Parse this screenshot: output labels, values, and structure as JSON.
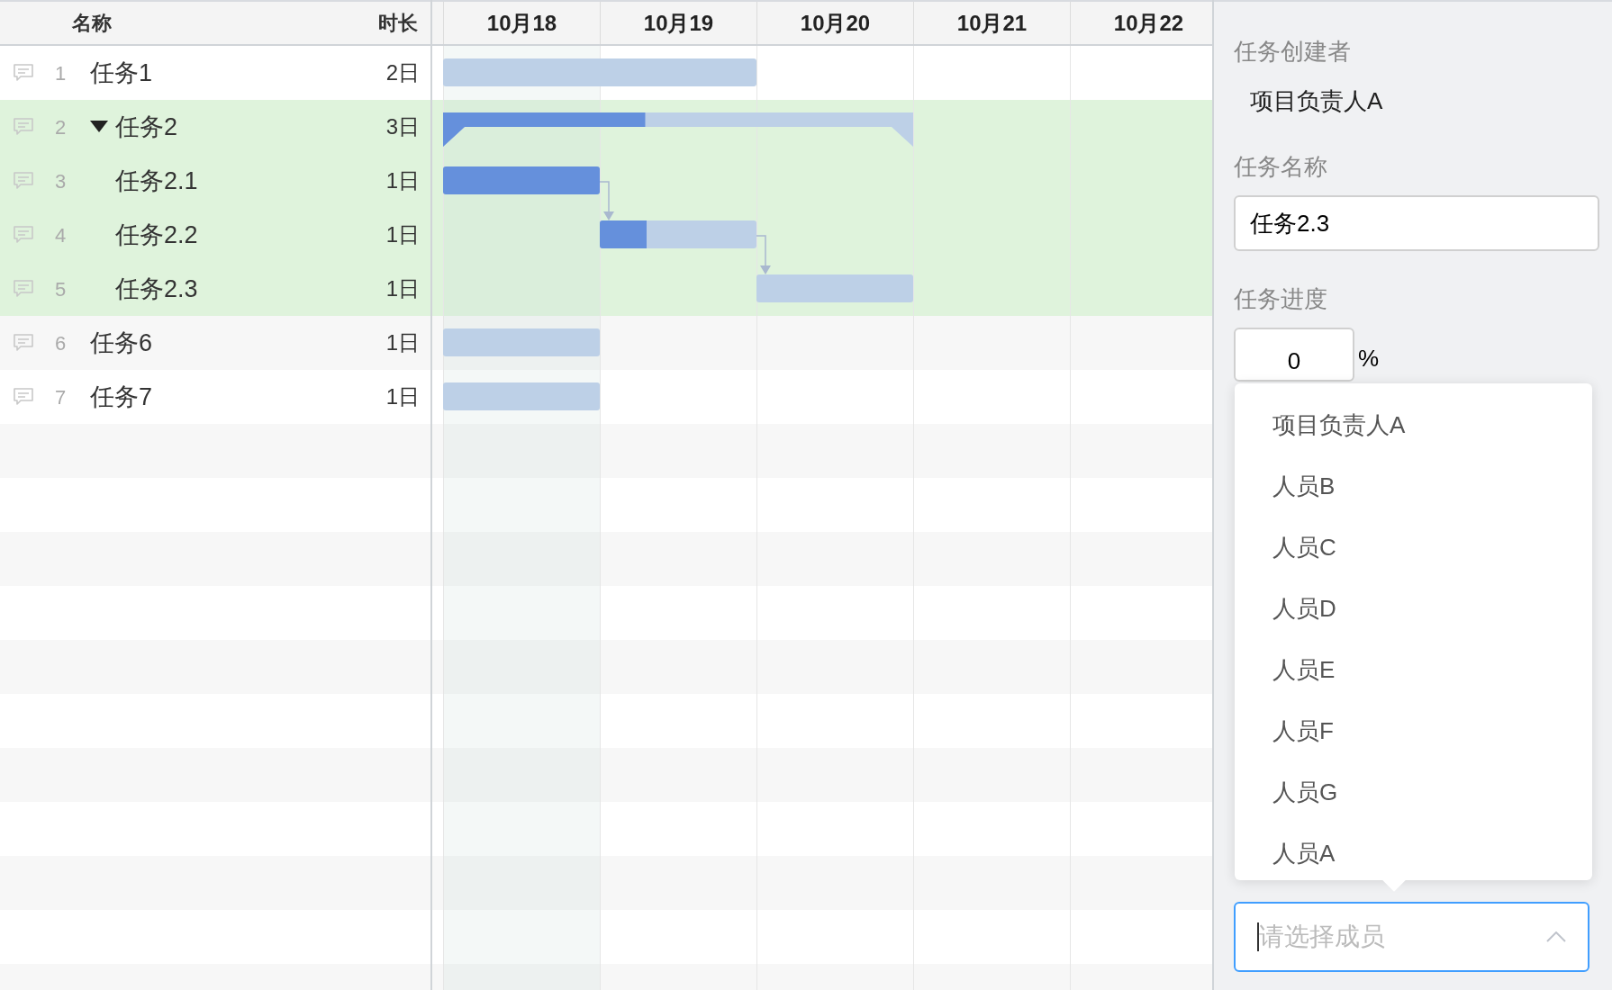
{
  "table": {
    "columns": [
      "名称",
      "时长"
    ],
    "rows": [
      {
        "no": "1",
        "name": "任务1",
        "duration": "2日",
        "selected": false
      },
      {
        "no": "2",
        "name": "任务2",
        "duration": "3日",
        "selected": true,
        "expanded": true,
        "bar": {
          "level": 0.43
        },
        "children": [
          {
            "no": "3",
            "name": "任务2.1",
            "duration": "1日",
            "selected": true,
            "bar": {
              "level": 1
            }
          },
          {
            "no": "4",
            "name": "任务2.2",
            "duration": "1日",
            "selected": true,
            "bar": {
              "level": 0.3
            }
          },
          {
            "no": "5",
            "name": "任务2.3",
            "duration": "1日",
            "selected": true
          }
        ]
      },
      {
        "no": "6",
        "name": "任务6",
        "duration": "1日",
        "selected": false
      },
      {
        "no": "7",
        "name": "任务7",
        "duration": "1日",
        "selected": false
      }
    ]
  },
  "timeline": {
    "days": [
      "10月18",
      "10月19",
      "10月20",
      "10月21",
      "10月22"
    ]
  },
  "panel": {
    "creator_label": "任务创建者",
    "creator": "项目负责人A",
    "name_label": "任务名称",
    "name_value": "任务2.3",
    "progress_label": "任务进度",
    "progress_value": "0",
    "progress_unit": "%",
    "member_select": {
      "placeholder": "请选择成员",
      "open": true,
      "options": [
        {
          "label": "项目负责人A",
          "selected": false
        },
        {
          "label": "人员B",
          "selected": false
        },
        {
          "label": "人员C",
          "selected": false
        },
        {
          "label": "人员D",
          "selected": false
        },
        {
          "label": "人员E",
          "selected": false
        },
        {
          "label": "人员F",
          "selected": false
        },
        {
          "label": "人员G",
          "selected": false
        },
        {
          "label": "人员A",
          "selected": false
        }
      ]
    }
  }
}
